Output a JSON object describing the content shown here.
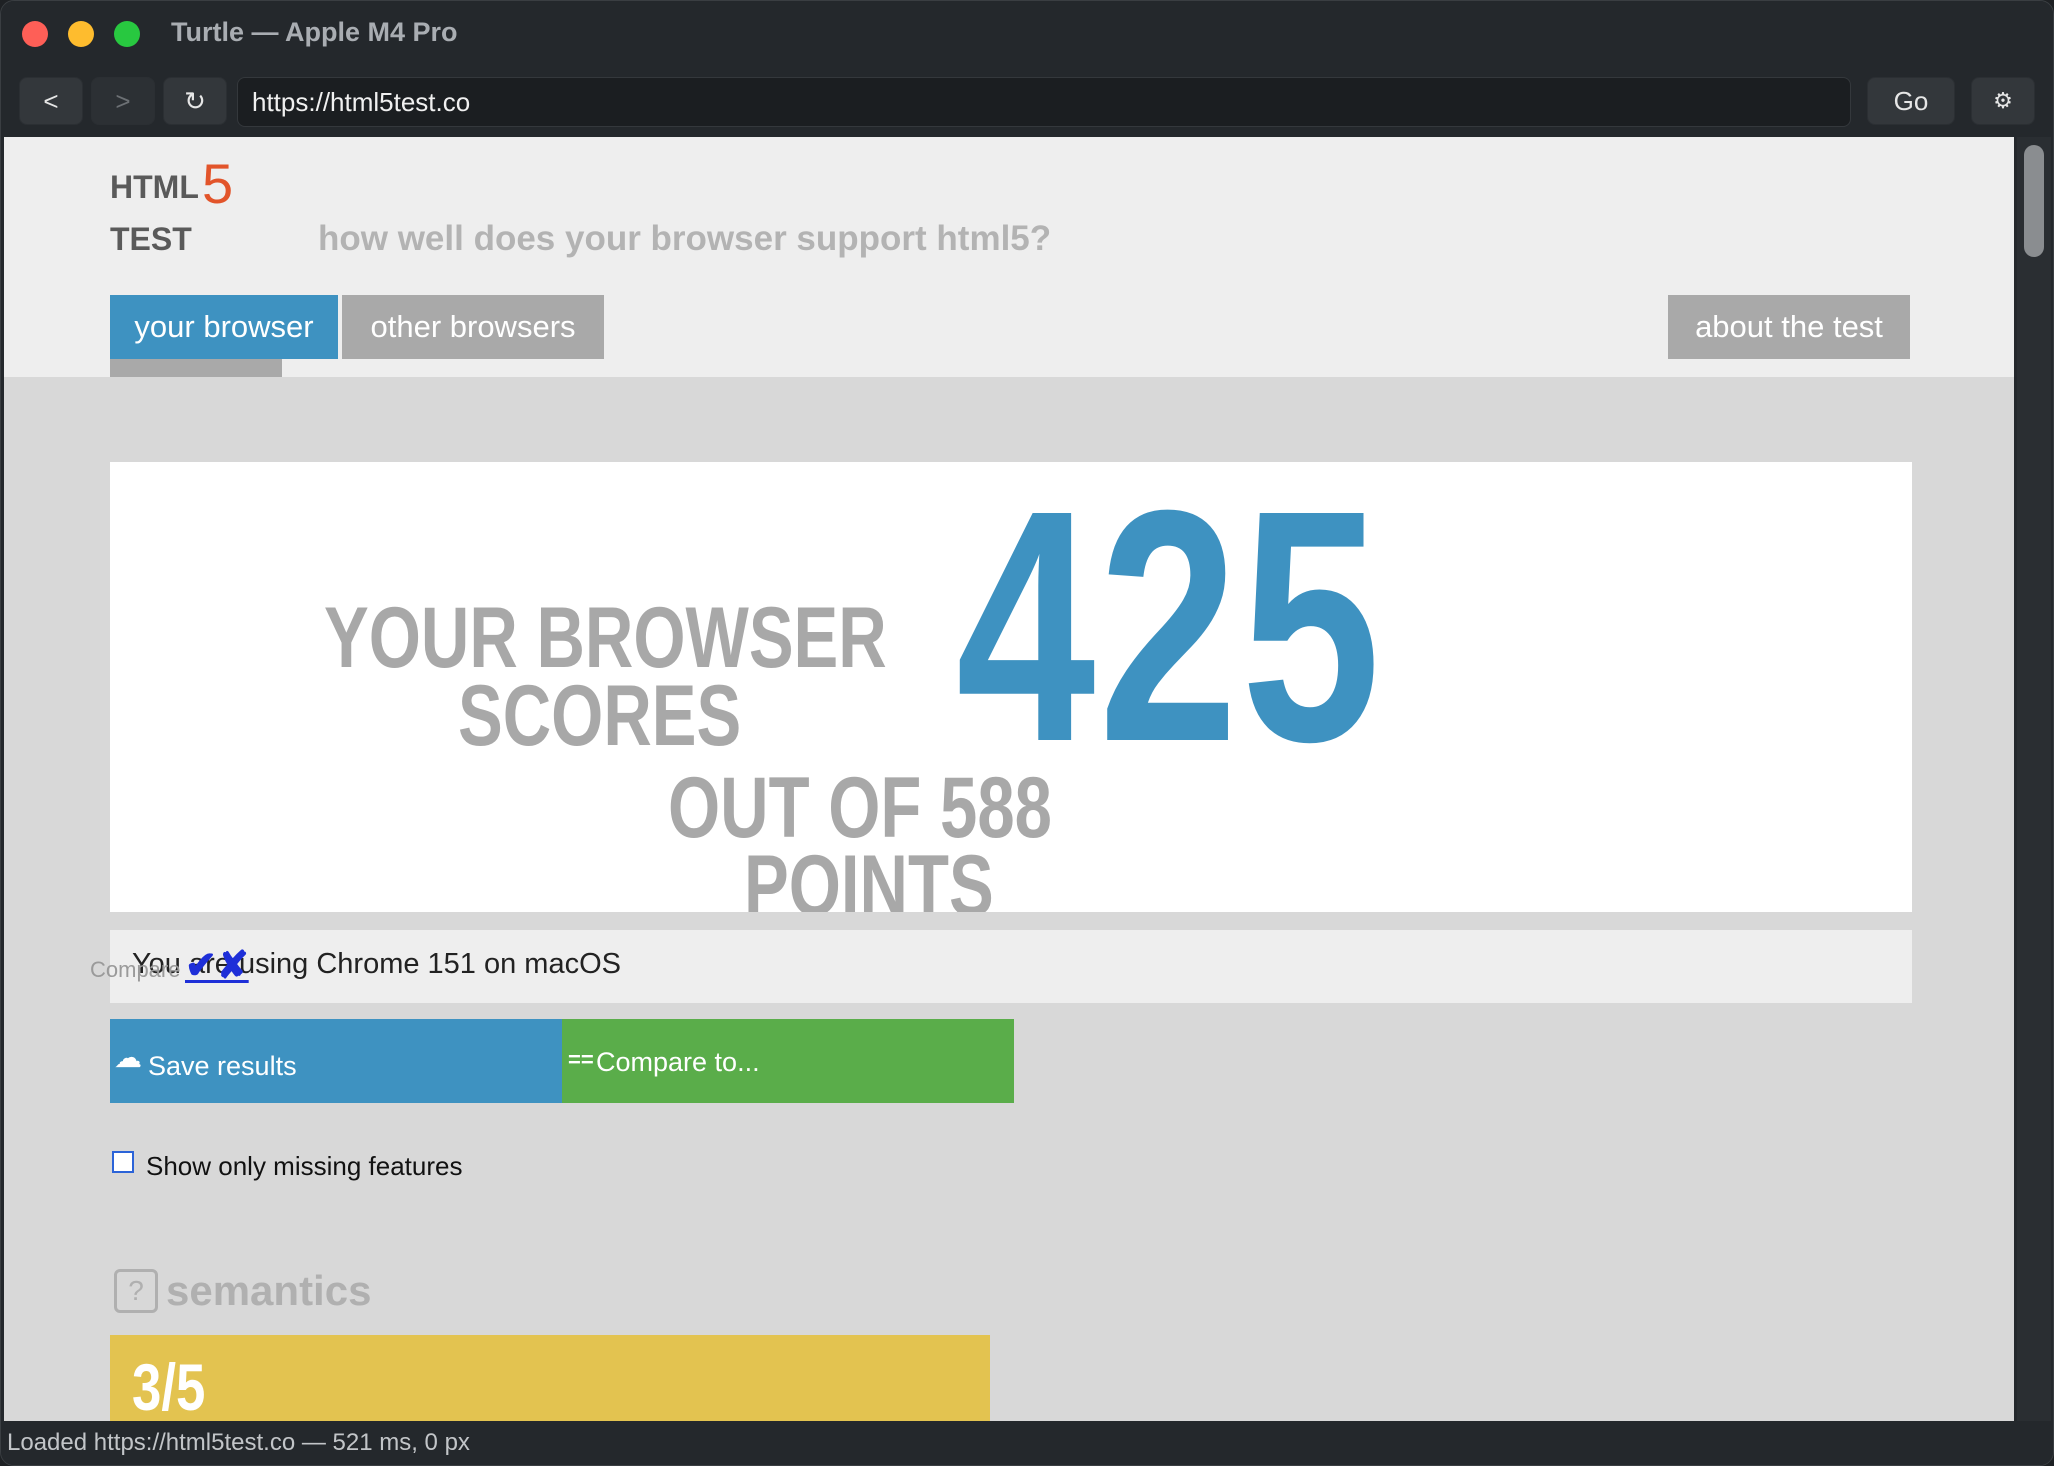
{
  "window": {
    "title": "Turtle — Apple M4 Pro"
  },
  "toolbar": {
    "back_label": "<",
    "forward_label": ">",
    "reload_label": "↻",
    "url": "https://html5test.co",
    "go_label": "Go",
    "settings_label": "⚙"
  },
  "site": {
    "logo_html": "HTML",
    "logo_five": "5",
    "logo_test": "TEST",
    "tagline": "how well does your browser support html5?",
    "tabs": [
      {
        "label": "your browser"
      },
      {
        "label": "other browsers"
      },
      {
        "label": "about the test"
      }
    ]
  },
  "score": {
    "label_line1": "YOUR BROWSER",
    "label_line2": "SCORES",
    "label_line3": "OUT OF 588",
    "label_line4": "POINTS",
    "value": "425",
    "max": 588
  },
  "using": {
    "text": "You are using Chrome 151 on macOS",
    "compare_ghost": "Compare",
    "checkmark": "✔✘"
  },
  "actions": {
    "save_label": "Save results",
    "save_icon": "☁",
    "compare_label": "Compare to...",
    "compare_icon": "=="
  },
  "filter": {
    "label": "Show only missing features"
  },
  "section": {
    "icon": "?",
    "title": "semantics",
    "score": "3/5"
  },
  "status": {
    "text": "Loaded https://html5test.co — 521 ms, 0 px"
  },
  "colors": {
    "accent_blue": "#3e92c1",
    "accent_green": "#5aad4a",
    "accent_yellow": "#e3c350",
    "logo_orange": "#e2542a"
  }
}
